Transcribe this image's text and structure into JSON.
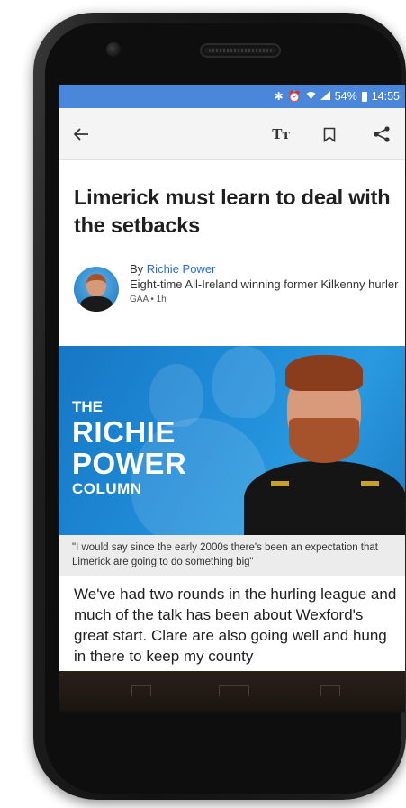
{
  "status_bar": {
    "icons": [
      "bluetooth-icon",
      "alarm-icon",
      "wifi-icon",
      "signal-icon"
    ],
    "battery": "54%",
    "time": "14:55",
    "bar_color": "#4a86d9"
  },
  "app_bar": {
    "back_icon": "←",
    "text_size_icon": "Tт",
    "bookmark_icon": "bookmark",
    "share_icon": "share"
  },
  "article": {
    "headline": "Limerick must learn to deal with the setbacks",
    "byline_prefix": "By ",
    "author": "Richie Power",
    "author_description": "Eight-time All-Ireland winning former Kilkenny hurler",
    "meta": "GAA • 1h",
    "hero": {
      "line1": "THE",
      "line2": "RICHIE",
      "line3": "POWER",
      "line4": "COLUMN"
    },
    "caption": "\"I would say since the early 2000s there's been an expectation that Limerick are going to do something big\"",
    "body": "We've had two rounds in the hurling league and much of the talk has been about Wexford's great start. Clare are also going well and hung in there to keep my county"
  },
  "colors": {
    "link": "#2a6fd1",
    "hero_blue": "#1e8ad6"
  }
}
